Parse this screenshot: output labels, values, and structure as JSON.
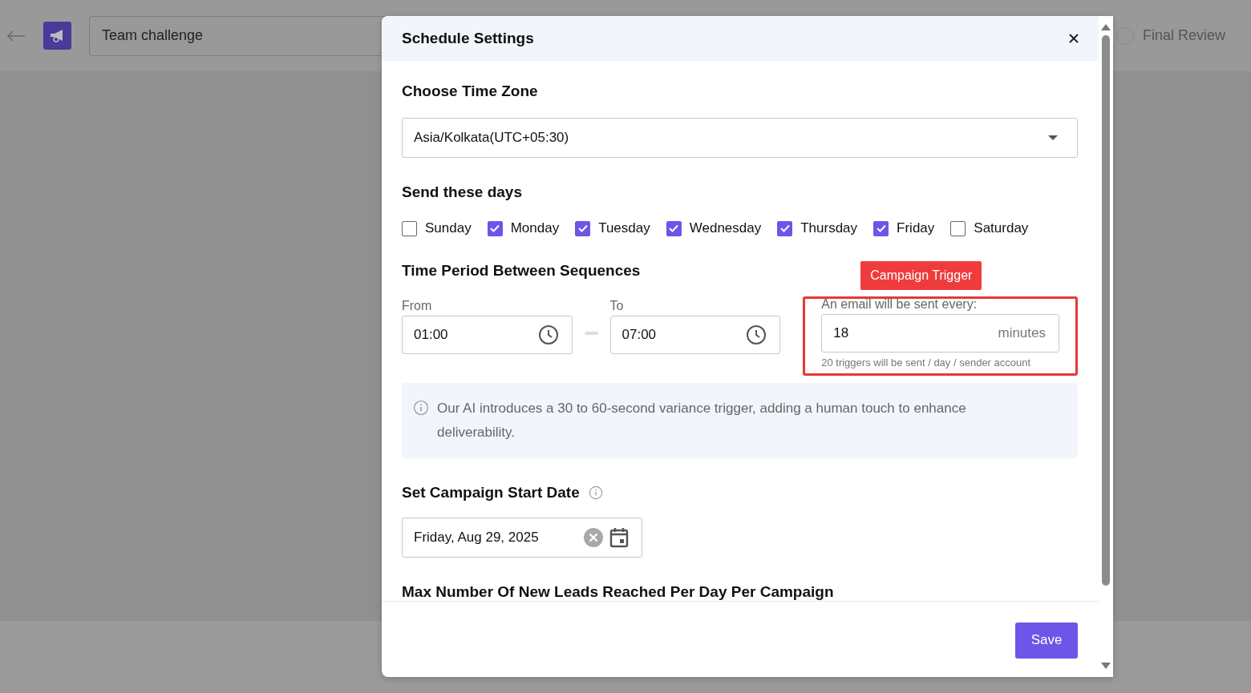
{
  "header": {
    "title": "Team challenge",
    "step": {
      "label": "Final Review",
      "completed": false
    }
  },
  "dialog": {
    "title": "Schedule Settings",
    "time_zone": {
      "heading": "Choose Time Zone",
      "value": "Asia/Kolkata(UTC+05:30)"
    },
    "days": {
      "heading": "Send these days",
      "items": [
        {
          "label": "Sunday",
          "checked": false
        },
        {
          "label": "Monday",
          "checked": true
        },
        {
          "label": "Tuesday",
          "checked": true
        },
        {
          "label": "Wednesday",
          "checked": true
        },
        {
          "label": "Thursday",
          "checked": true
        },
        {
          "label": "Friday",
          "checked": true
        },
        {
          "label": "Saturday",
          "checked": false
        }
      ]
    },
    "time_period": {
      "heading": "Time Period Between Sequences",
      "from": {
        "label": "From",
        "value": "01:00"
      },
      "to": {
        "label": "To",
        "value": "07:00"
      }
    },
    "trigger": {
      "badge": "Campaign Trigger",
      "label": "An email will be sent every:",
      "value": "18",
      "unit": "minutes",
      "note": "20 triggers will be sent / day / sender account"
    },
    "info": "Our AI introduces a 30 to 60-second variance trigger, adding a human touch to enhance deliverability.",
    "start_date": {
      "heading": "Set Campaign Start Date",
      "value": "Friday, Aug 29, 2025"
    },
    "max_leads_heading": "Max Number Of New Leads Reached Per Day Per Campaign",
    "save": "Save"
  }
}
